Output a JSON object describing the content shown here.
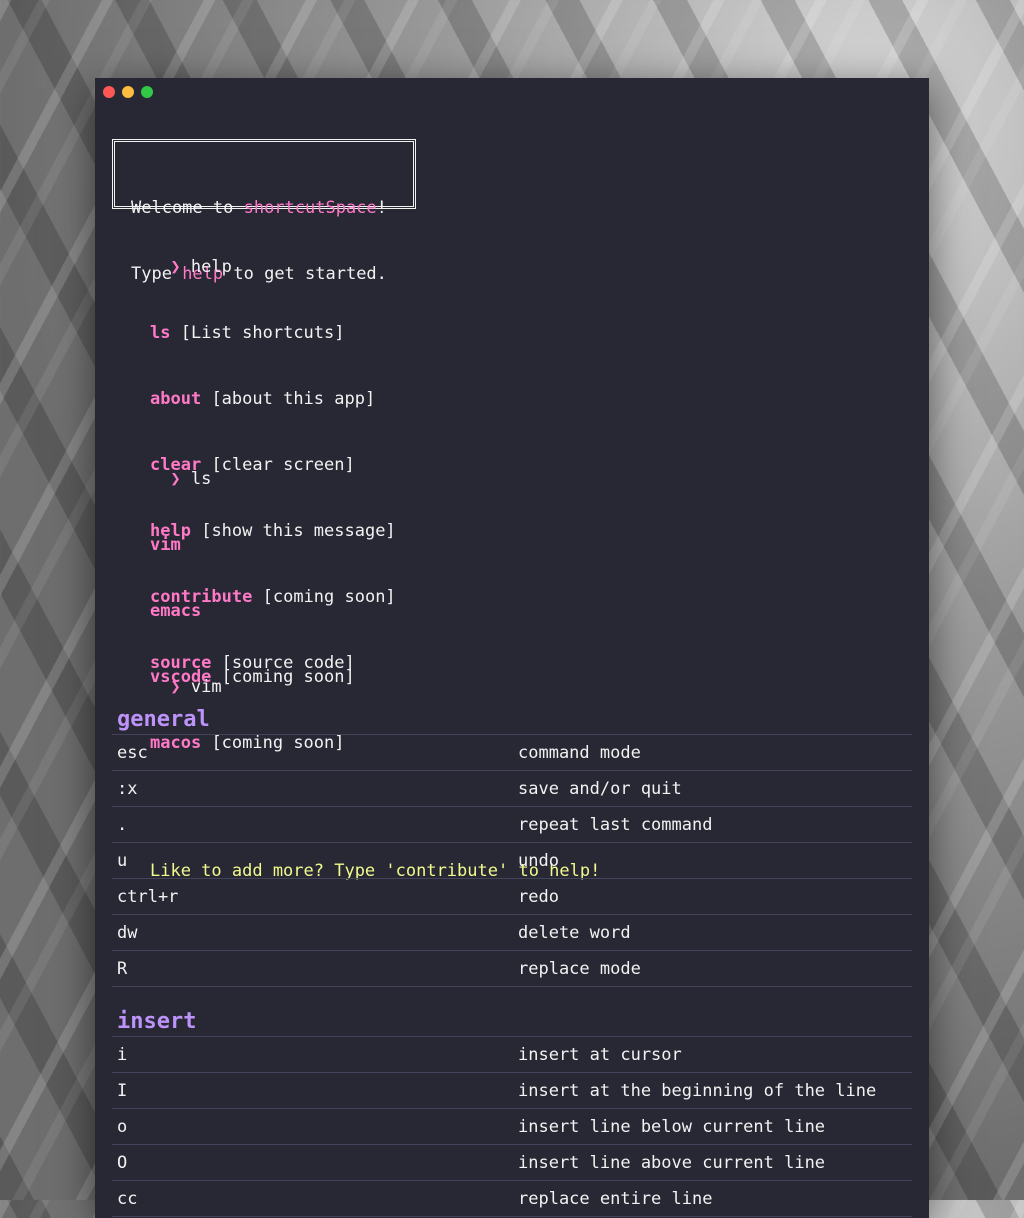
{
  "window": {
    "controls": [
      "close",
      "minimize",
      "zoom"
    ]
  },
  "banner": {
    "line1_pre": "Welcome to ",
    "line1_app": "shortcutSpace",
    "line1_post": "!",
    "line2_pre": "Type ",
    "line2_cmd": "help",
    "line2_post": " to get started."
  },
  "prompt_symbol": "❯",
  "commands": {
    "help": {
      "input": "help",
      "items": [
        {
          "cmd": "ls",
          "desc": "[List shortcuts]"
        },
        {
          "cmd": "about",
          "desc": "[about this app]"
        },
        {
          "cmd": "clear",
          "desc": "[clear screen]"
        },
        {
          "cmd": "help",
          "desc": "[show this message]"
        },
        {
          "cmd": "contribute",
          "desc": "[coming soon]"
        },
        {
          "cmd": "source",
          "desc": "[source code]"
        }
      ]
    },
    "ls": {
      "input": "ls",
      "items": [
        {
          "cmd": "vim",
          "desc": ""
        },
        {
          "cmd": "emacs",
          "desc": ""
        },
        {
          "cmd": "vscode",
          "desc": "[coming soon]"
        },
        {
          "cmd": "macos",
          "desc": "[coming soon]"
        }
      ],
      "footer": "Like to add more? Type 'contribute' to help!"
    },
    "vim": {
      "input": "vim"
    }
  },
  "sections": [
    {
      "title": "general",
      "rows": [
        {
          "key": "esc",
          "desc": "command mode"
        },
        {
          "key": ":x",
          "desc": "save and/or quit"
        },
        {
          "key": ".",
          "desc": "repeat last command"
        },
        {
          "key": "u",
          "desc": "undo"
        },
        {
          "key": "ctrl+r",
          "desc": "redo"
        },
        {
          "key": "dw",
          "desc": "delete word"
        },
        {
          "key": "R",
          "desc": "replace mode"
        }
      ]
    },
    {
      "title": "insert",
      "rows": [
        {
          "key": "i",
          "desc": "insert at cursor"
        },
        {
          "key": "I",
          "desc": "insert at the beginning of the line"
        },
        {
          "key": "o",
          "desc": "insert line below current line"
        },
        {
          "key": "O",
          "desc": "insert line above current line"
        },
        {
          "key": "cc",
          "desc": "replace entire line"
        }
      ]
    }
  ]
}
